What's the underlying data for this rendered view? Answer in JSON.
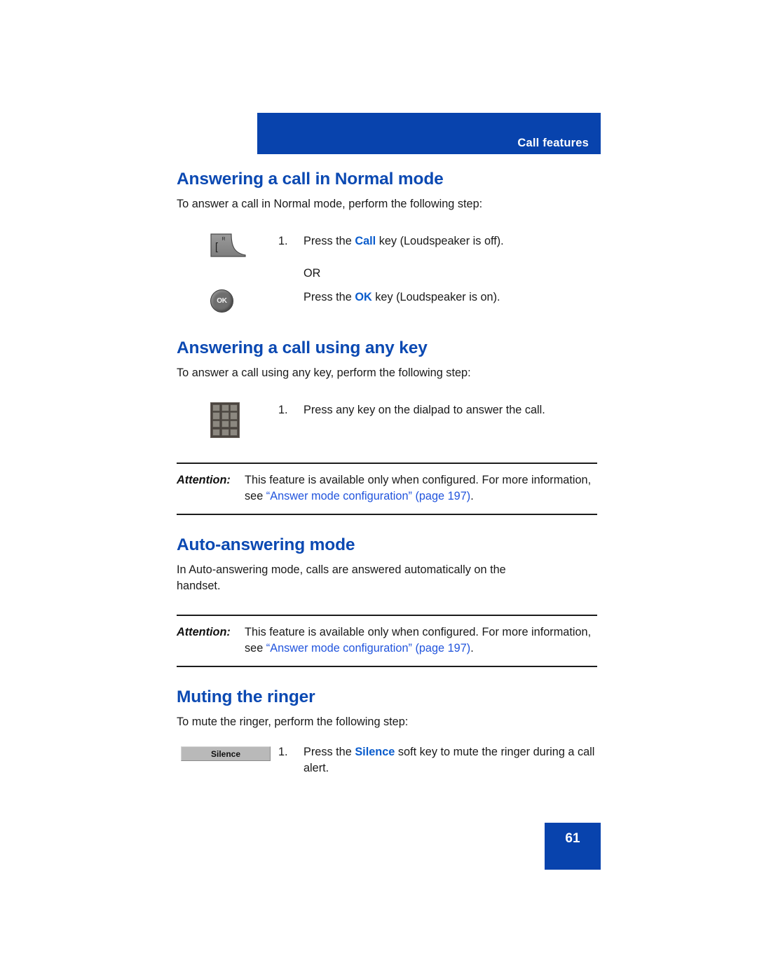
{
  "header": {
    "running_head": "Call features"
  },
  "sections": [
    {
      "id": "answering-normal-mode",
      "title": "Answering a call in Normal mode",
      "intro": "To answer a call in Normal mode, perform the following step:",
      "steps": [
        {
          "number": "1.",
          "icon": "call-key-icon",
          "text_before": "Press the ",
          "keyword": "Call",
          "text_after": " key (Loudspeaker is off)."
        }
      ],
      "or_label": "OR",
      "alt_step": {
        "icon": "ok-key-icon",
        "text_before": "Press the ",
        "keyword": "OK",
        "text_after": " key (Loudspeaker is on)."
      }
    },
    {
      "id": "answering-any-key",
      "title": "Answering a call using any key",
      "intro": "To answer a call using any key, perform the following step:",
      "steps": [
        {
          "number": "1.",
          "icon": "dialpad-icon",
          "text": "Press any key on the dialpad to answer the call."
        }
      ]
    },
    {
      "id": "auto-answering-mode",
      "title": "Auto-answering mode",
      "intro": "In Auto-answering mode, calls are answered automatically on the handset."
    },
    {
      "id": "muting-the-ringer",
      "title": "Muting the ringer",
      "intro": "To mute the ringer, perform the following step:",
      "steps": [
        {
          "number": "1.",
          "icon": "silence-soft-key",
          "soft_key_label": "Silence",
          "text_before": "Press the ",
          "keyword": "Silence",
          "text_after": " soft key to mute the ringer during a call alert."
        }
      ]
    }
  ],
  "notes": [
    {
      "label": "Attention:",
      "text_before": "This feature is available only when configured. For more information, see ",
      "link": "“Answer mode configuration” (page 197)",
      "text_after": "."
    },
    {
      "label": "Attention:",
      "text_before": "This feature is available only when configured. For more information, see ",
      "link": "“Answer mode configuration” (page 197)",
      "text_after": "."
    }
  ],
  "icons": {
    "call_key_letter": "R",
    "ok_key_label": "OK"
  },
  "footer": {
    "page_number": "61"
  },
  "colors": {
    "brand_blue": "#0843ad",
    "heading_blue": "#0b49b2",
    "keyword_blue": "#0a5ccc",
    "link_blue": "#2255dd"
  }
}
